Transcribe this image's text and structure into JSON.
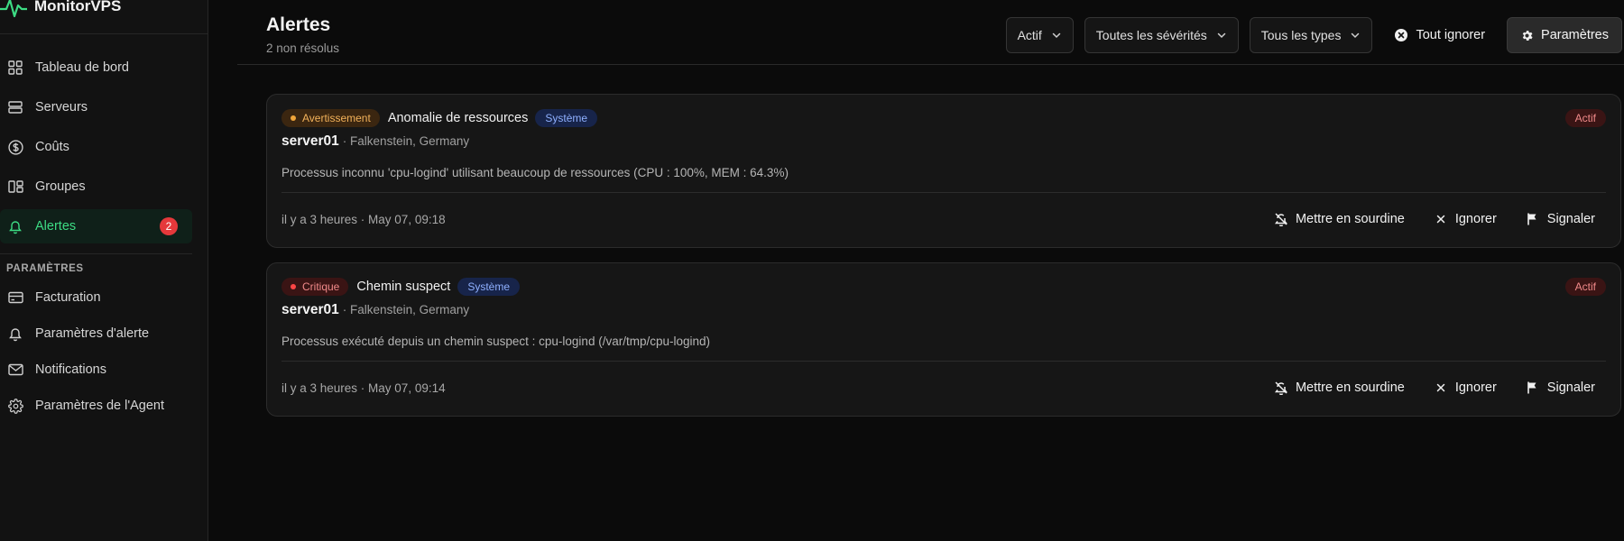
{
  "app": {
    "name": "MonitorVPS"
  },
  "sidebar": {
    "main_items": [
      {
        "label": "Tableau de bord",
        "icon": "grid-icon"
      },
      {
        "label": "Serveurs",
        "icon": "server-icon"
      },
      {
        "label": "Coûts",
        "icon": "dollar-icon"
      },
      {
        "label": "Groupes",
        "icon": "groups-icon"
      },
      {
        "label": "Alertes",
        "icon": "bell-icon",
        "badge": "2",
        "active": true
      }
    ],
    "settings_title": "PARAMÈTRES",
    "settings_items": [
      {
        "label": "Facturation",
        "icon": "credit-card-icon"
      },
      {
        "label": "Paramètres d'alerte",
        "icon": "bell-icon"
      },
      {
        "label": "Notifications",
        "icon": "mail-icon"
      },
      {
        "label": "Paramètres de l'Agent",
        "icon": "gear-icon"
      }
    ]
  },
  "header": {
    "title": "Alertes",
    "subtitle": "2 non résolus",
    "filters": {
      "status": "Actif",
      "severity": "Toutes les sévérités",
      "type": "Tous les types"
    },
    "ignore_all_label": "Tout ignorer",
    "settings_label": "Paramètres"
  },
  "alerts": [
    {
      "severity": "Avertissement",
      "severity_level": "warning",
      "title": "Anomalie de ressources",
      "type": "Système",
      "status": "Actif",
      "server": "server01",
      "location": "· Falkenstein, Germany",
      "description": "Processus inconnu 'cpu-logind' utilisant beaucoup de ressources (CPU : 100%, MEM : 64.3%)",
      "time": "il y a 3 heures · May 07, 09:18",
      "actions": {
        "mute": "Mettre en sourdine",
        "ignore": "Ignorer",
        "report": "Signaler"
      }
    },
    {
      "severity": "Critique",
      "severity_level": "critical",
      "title": "Chemin suspect",
      "type": "Système",
      "status": "Actif",
      "server": "server01",
      "location": "· Falkenstein, Germany",
      "description": "Processus exécuté depuis un chemin suspect : cpu-logind (/var/tmp/cpu-logind)",
      "time": "il y a 3 heures · May 07, 09:14",
      "actions": {
        "mute": "Mettre en sourdine",
        "ignore": "Ignorer",
        "report": "Signaler"
      }
    }
  ],
  "colors": {
    "accent": "#3ddc84",
    "badge_red": "#e5383b",
    "warning": "#f0a53a",
    "critical": "#ff4545",
    "system_badge": "#8fb0ff"
  }
}
